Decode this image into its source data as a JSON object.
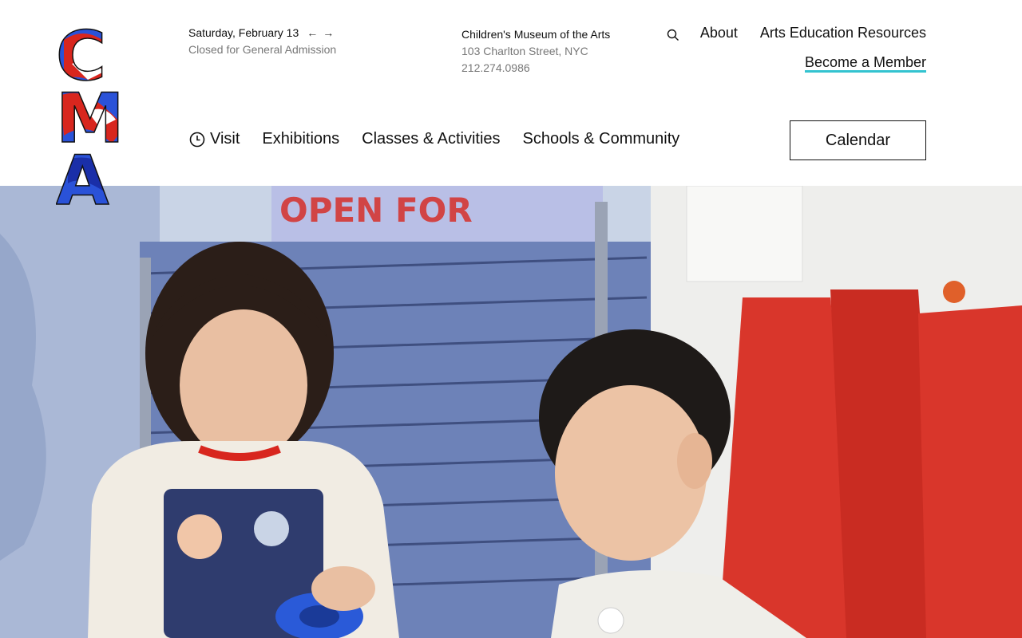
{
  "header": {
    "date": "Saturday, February 13",
    "prev_arrow": "←",
    "next_arrow": "→",
    "admission_status": "Closed for General Admission"
  },
  "address": {
    "name": "Children's Museum of the Arts",
    "street": "103 Charlton Street, NYC",
    "phone": "212.274.0986"
  },
  "top_links": {
    "about": "About",
    "resources": "Arts Education Resources",
    "member": "Become a Member"
  },
  "nav": {
    "visit": "Visit",
    "exhibitions": "Exhibitions",
    "classes": "Classes & Activities",
    "schools": "Schools & Community"
  },
  "calendar_button": "Calendar",
  "logo": {
    "letters": [
      "C",
      "M",
      "A"
    ]
  },
  "colors": {
    "accent_underline": "#33c3d0",
    "logo_blue": "#2a52d8",
    "logo_red": "#d8261e"
  }
}
